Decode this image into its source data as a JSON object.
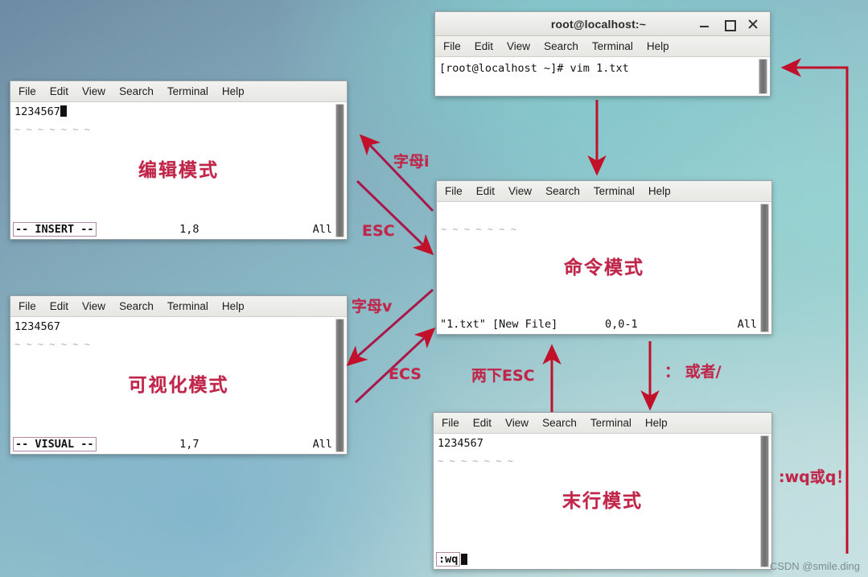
{
  "watermark": "CSDN @smile.ding",
  "menu": [
    "File",
    "Edit",
    "View",
    "Search",
    "Terminal",
    "Help"
  ],
  "windows": {
    "terminal": {
      "title": "root@localhost:~",
      "prompt_line": "[root@localhost ~]# vim 1.txt",
      "buttons": {
        "minimize": "minimize",
        "maximize": "maximize",
        "close": "close"
      }
    },
    "insert": {
      "text_line": "1234567",
      "mode_label": "编辑模式",
      "status_mode": "-- INSERT --",
      "status_pos": "1,8",
      "status_all": "All"
    },
    "visual": {
      "text_line": "1234567",
      "mode_label": "可视化模式",
      "status_mode": "-- VISUAL --",
      "status_pos": "1,7",
      "status_all": "All"
    },
    "command": {
      "text_line": "",
      "mode_label": "命令模式",
      "status_file": "\"1.txt\" [New File]",
      "status_pos": "0,0-1",
      "status_all": "All"
    },
    "lastline": {
      "text_line": "1234567",
      "mode_label": "末行模式",
      "status_cmd": ":wq"
    }
  },
  "annotations": {
    "letter_i": "字母i",
    "esc_upper": "ESC",
    "letter_v": "字母v",
    "ecs_lower": "ECS",
    "two_esc": "两下ESC",
    "colon_or_slash": "： 或者/",
    "wq_or_q": ":wq或q！"
  },
  "colors": {
    "accent_red": "#c0254a",
    "arrow_red": "#c20f2a",
    "background_teal": "#84cece",
    "background_blue": "#6d8ba3"
  }
}
